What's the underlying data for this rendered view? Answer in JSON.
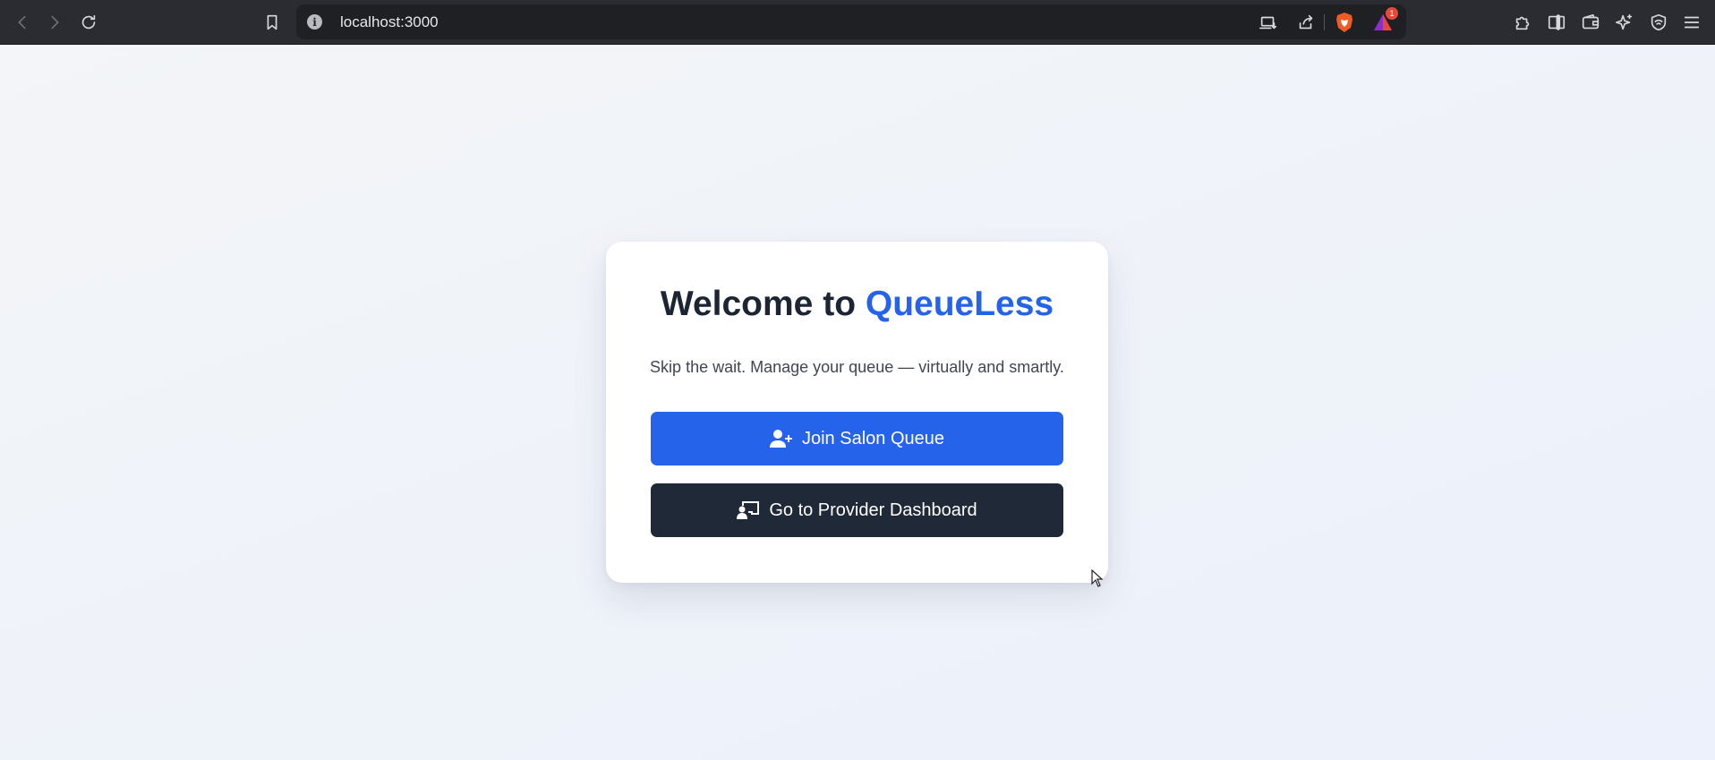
{
  "browser": {
    "url": "localhost:3000",
    "notification_count": "1",
    "icons": [
      "back-icon",
      "forward-icon",
      "reload-icon",
      "bookmark-icon",
      "site-info-icon",
      "install-app-icon",
      "share-icon",
      "brave-shields-icon",
      "brave-rewards-icon",
      "extensions-icon",
      "sidebar-icon",
      "wallet-icon",
      "leo-ai-icon",
      "vpn-icon",
      "menu-icon"
    ]
  },
  "welcome": {
    "title_prefix": "Welcome to ",
    "title_brand": "QueueLess",
    "subtitle": "Skip the wait. Manage your queue — virtually and smartly.",
    "join_button": "Join Salon Queue",
    "provider_button": "Go to Provider Dashboard"
  },
  "colors": {
    "accent": "#2563eb",
    "dark_button": "#1f2937",
    "heading": "#1c2533",
    "background": "#eef2f9"
  }
}
